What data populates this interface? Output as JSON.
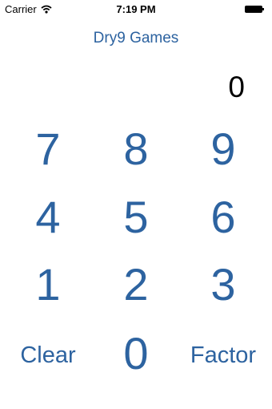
{
  "status_bar": {
    "carrier": "Carrier",
    "time": "7:19 PM",
    "wifi_icon": "wifi-icon",
    "battery_icon": "battery-icon"
  },
  "app": {
    "title": "Dry9 Games",
    "display": "0",
    "accent_color": "#2d63a0"
  },
  "keypad": {
    "rows": [
      [
        "7",
        "8",
        "9"
      ],
      [
        "4",
        "5",
        "6"
      ],
      [
        "1",
        "2",
        "3"
      ]
    ],
    "clear_label": "Clear",
    "zero_label": "0",
    "factor_label": "Factor"
  }
}
